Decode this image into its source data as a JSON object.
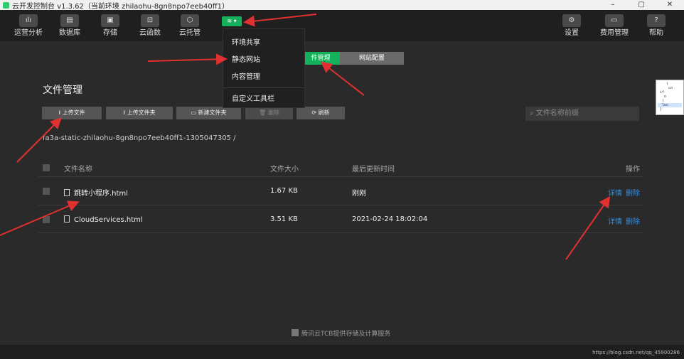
{
  "window": {
    "title": "云开发控制台 v1.3.62（当前环境 zhilaohu-8gn8npo7eeb40ff1）",
    "minimize": "–",
    "maximize": "▢",
    "close": "✕"
  },
  "toolbar": {
    "left": [
      {
        "label": "运营分析",
        "icon": "chart-icon"
      },
      {
        "label": "数据库",
        "icon": "database-icon"
      },
      {
        "label": "存储",
        "icon": "storage-icon"
      },
      {
        "label": "云函数",
        "icon": "function-icon"
      },
      {
        "label": "云托管",
        "icon": "container-icon"
      }
    ],
    "right": [
      {
        "label": "设置",
        "icon": "gear-icon"
      },
      {
        "label": "费用管理",
        "icon": "billing-icon"
      },
      {
        "label": "帮助",
        "icon": "help-icon"
      }
    ]
  },
  "env_dropdown": {
    "items": [
      "环境共享",
      "静态网站",
      "内容管理",
      "自定义工具栏"
    ]
  },
  "tabs": {
    "active": "件管理",
    "inactive": "网站配置"
  },
  "page_title": "文件管理",
  "actions": {
    "upload_file": "上传文件",
    "upload_folder": "上传文件夹",
    "new_folder": "新建文件夹",
    "delete": "删除",
    "refresh": "刷新"
  },
  "search": {
    "placeholder": "文件名称前缀"
  },
  "path": "fa3a-static-zhilaohu-8gn8npo7eeb40ff1-1305047305 /",
  "table": {
    "headers": {
      "name": "文件名称",
      "size": "文件大小",
      "time": "最后更新时间",
      "ops": "操作"
    },
    "rows": [
      {
        "name": "跳转小程序.html",
        "size": "1.67 KB",
        "time": "刚刚",
        "detail": "详情",
        "delete": "删除"
      },
      {
        "name": "CloudServices.html",
        "size": "3.51 KB",
        "time": "2021-02-24 18:02:04",
        "detail": "详情",
        "delete": "删除"
      }
    ]
  },
  "footer": "腾讯云TCB提供存储及计算服务",
  "watermark": "https://blog.csdn.net/qq_45900286",
  "colors": {
    "accent": "#17b05a",
    "link": "#2f8fe8",
    "arrow": "#e03030"
  }
}
